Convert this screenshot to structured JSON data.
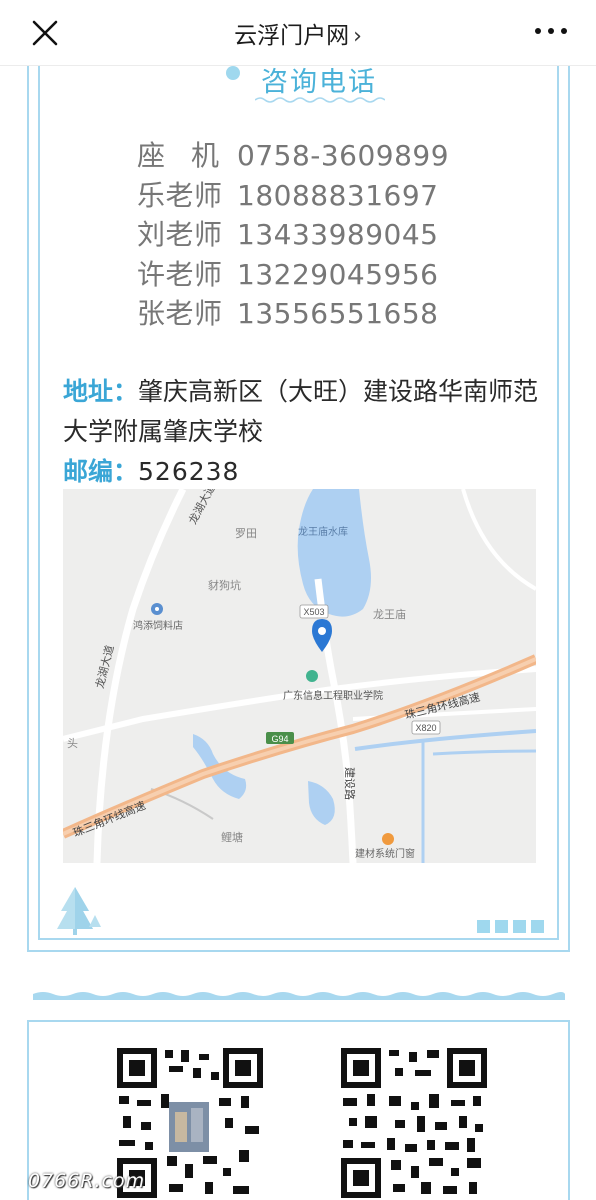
{
  "topbar": {
    "title": "云浮门户网",
    "chevron": "›",
    "close_icon": "close-icon",
    "more_icon": "more-dots-icon"
  },
  "section": {
    "title": "咨询电话"
  },
  "contacts": [
    {
      "label": "座机",
      "phone": "0758-3609899"
    },
    {
      "label": "乐老师",
      "phone": "18088831697"
    },
    {
      "label": "刘老师",
      "phone": "13433989045"
    },
    {
      "label": "许老师",
      "phone": "13229045956"
    },
    {
      "label": "张老师",
      "phone": "13556551658"
    }
  ],
  "address": {
    "key": "地址：",
    "value": "肇庆高新区（大旺）建设路华南师范大学附属肇庆学校"
  },
  "postal": {
    "key": "邮编：",
    "value": "526238"
  },
  "map": {
    "labels": {
      "reservoir": "龙王庙水库",
      "luotian": "罗田",
      "caigoukeng": "豺狗坑",
      "x503": "X503",
      "longwangmiao": "龙王庙",
      "hongtian": "鸿添饲料店",
      "longhu_top": "龙湖大道",
      "longhu_left": "龙湖大道",
      "college": "广东信息工程职业学院",
      "ring_top": "珠三角环线高速",
      "ring_bottom": "珠三角环线高速",
      "x820": "X820",
      "g94": "G94",
      "jianshe": "建设路",
      "tou": "头",
      "litang": "鲤塘",
      "store": "建材系统门窗"
    },
    "colors": {
      "background": "#eeeeed",
      "water": "#aed0f2",
      "highway": "#f2b78a",
      "pin": "#2b78d4"
    }
  },
  "colors": {
    "accent": "#4bb2d9",
    "frame": "#a8d8ef"
  },
  "watermark": "0766R.com"
}
